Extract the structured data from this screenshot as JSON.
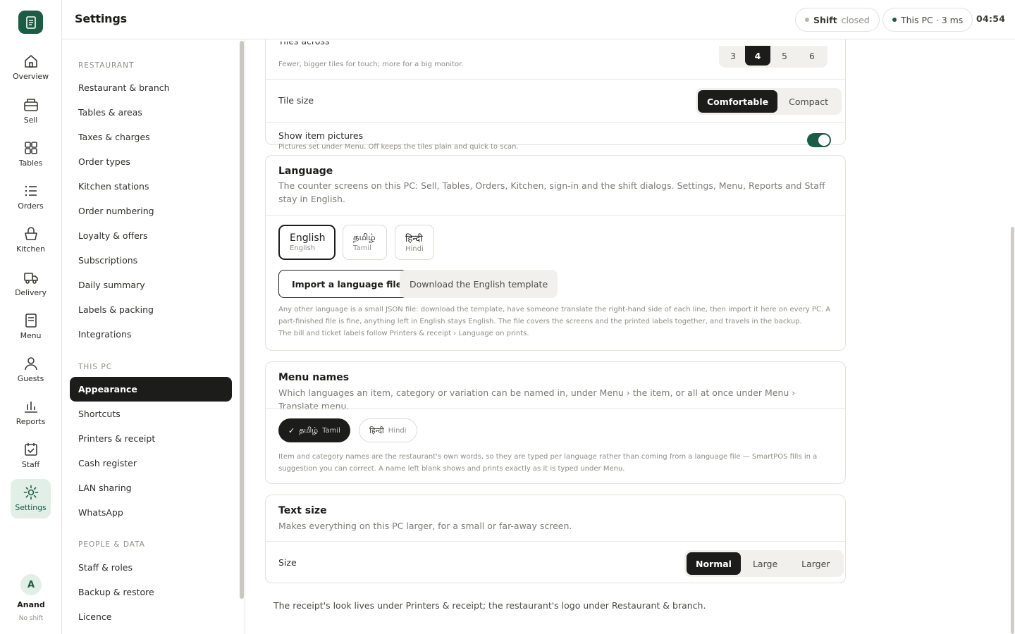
{
  "app": {
    "page_title": "Settings",
    "clock": "04:54"
  },
  "status": {
    "shift_label": "Shift",
    "shift_state": "closed",
    "pc_status": "This PC · 3 ms"
  },
  "rail": {
    "items": [
      {
        "label": "Overview",
        "icon": "home-icon"
      },
      {
        "label": "Sell",
        "icon": "register-icon"
      },
      {
        "label": "Tables",
        "icon": "grid-icon"
      },
      {
        "label": "Orders",
        "icon": "list-icon"
      },
      {
        "label": "Kitchen",
        "icon": "basket-icon"
      },
      {
        "label": "Delivery",
        "icon": "truck-icon"
      },
      {
        "label": "Menu",
        "icon": "document-icon"
      },
      {
        "label": "Guests",
        "icon": "person-icon"
      },
      {
        "label": "Reports",
        "icon": "bar-chart-icon"
      },
      {
        "label": "Staff",
        "icon": "calendar-check-icon"
      },
      {
        "label": "Settings",
        "icon": "gear-icon"
      }
    ],
    "user_initial": "A",
    "user_name": "Anand",
    "user_shift": "No shift"
  },
  "settings_nav": {
    "sections": [
      {
        "heading": "RESTAURANT",
        "items": [
          "Restaurant & branch",
          "Tables & areas",
          "Taxes & charges",
          "Order types",
          "Kitchen stations",
          "Order numbering",
          "Loyalty & offers",
          "Subscriptions",
          "Daily summary",
          "Labels & packing",
          "Integrations"
        ]
      },
      {
        "heading": "THIS PC",
        "items": [
          "Appearance",
          "Shortcuts",
          "Printers & receipt",
          "Cash register",
          "LAN sharing",
          "WhatsApp"
        ]
      },
      {
        "heading": "PEOPLE & DATA",
        "items": [
          "Staff & roles",
          "Backup & restore",
          "Licence"
        ]
      }
    ],
    "active": "Appearance"
  },
  "tiles": {
    "across_label": "Tiles across",
    "across_sub": "Fewer, bigger tiles for touch; more for a big monitor.",
    "across_options": [
      "3",
      "4",
      "5",
      "6"
    ],
    "across_selected": "4",
    "size_label": "Tile size",
    "size_options": [
      "Comfortable",
      "Compact"
    ],
    "size_selected": "Comfortable",
    "pictures_label": "Show item pictures",
    "pictures_sub": "Pictures set under Menu. Off keeps the tiles plain and quick to scan.",
    "pictures_on": true
  },
  "language": {
    "title": "Language",
    "desc": "The counter screens on this PC: Sell, Tables, Orders, Kitchen, sign-in and the shift dialogs. Settings, Menu, Reports and Staff stay in English.",
    "options": [
      {
        "native": "English",
        "english": "English"
      },
      {
        "native": "தமிழ்",
        "english": "Tamil"
      },
      {
        "native": "हिन्दी",
        "english": "Hindi"
      }
    ],
    "selected": "English",
    "import_label": "Import a language file",
    "download_label": "Download the English template",
    "note1": "Any other language is a small JSON file: download the template, have someone translate the right-hand side of each line, then import it here on every PC. A part-finished file is fine, anything left in English stays English. The file covers the screens and the printed labels together, and travels in the backup.",
    "note2": "The bill and ticket labels follow Printers & receipt › Language on prints."
  },
  "menu_names": {
    "title": "Menu names",
    "desc": "Which languages an item, category or variation can be named in, under Menu › the item, or all at once under Menu › Translate menu.",
    "chips": [
      {
        "check": "✓",
        "native": "தமிழ்",
        "english": "Tamil",
        "on": true
      },
      {
        "check": "",
        "native": "हिन्दी",
        "english": "Hindi",
        "on": false
      }
    ],
    "note": "Item and category names are the restaurant's own words, so they are typed per language rather than coming from a language file — SmartPOS fills in a suggestion you can correct. A name left blank shows and prints exactly as it is typed under Menu."
  },
  "text_size": {
    "title": "Text size",
    "desc": "Makes everything on this PC larger, for a small or far-away screen.",
    "size_label": "Size",
    "options": [
      "Normal",
      "Large",
      "Larger"
    ],
    "selected": "Normal"
  },
  "footer_note": "The receipt's look lives under Printers & receipt; the restaurant's logo under Restaurant & branch.",
  "colors": {
    "accent": "#1d5c44",
    "accent_light": "#e2efe7",
    "dark": "#1c1c1a"
  }
}
